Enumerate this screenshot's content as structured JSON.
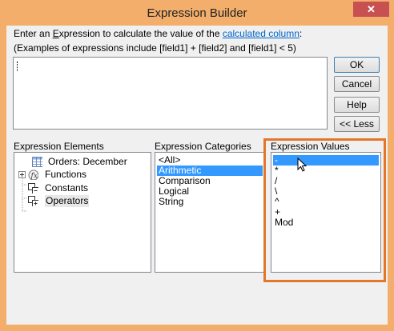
{
  "window": {
    "title": "Expression Builder",
    "close_label": "✕"
  },
  "instructions": {
    "line1_prefix": "Enter an ",
    "line1_underlined": "E",
    "line1_middle": "xpression to calculate the value of the ",
    "line1_link": "calculated column",
    "line1_suffix": ":",
    "line2": "(Examples of expressions include [field1] + [field2] and [field1] < 5)"
  },
  "buttons": {
    "ok": "OK",
    "cancel": "Cancel",
    "help": "Help",
    "less": "<< Less"
  },
  "panels": {
    "elements_label": "Expression Elements",
    "categories_label": "Expression Categories",
    "values_label": "Expression Values"
  },
  "elements": [
    {
      "label": "Orders: December",
      "icon": "table-icon"
    },
    {
      "label": "Functions",
      "icon": "function-icon"
    },
    {
      "label": "Constants",
      "icon": "constants-icon"
    },
    {
      "label": "Operators",
      "icon": "operators-icon"
    }
  ],
  "categories": [
    "<All>",
    "Arithmetic",
    "Comparison",
    "Logical",
    "String"
  ],
  "categories_selected": "Arithmetic",
  "values": [
    "-",
    "*",
    "/",
    "\\",
    "^",
    "+",
    "Mod"
  ],
  "values_selected": "-"
}
